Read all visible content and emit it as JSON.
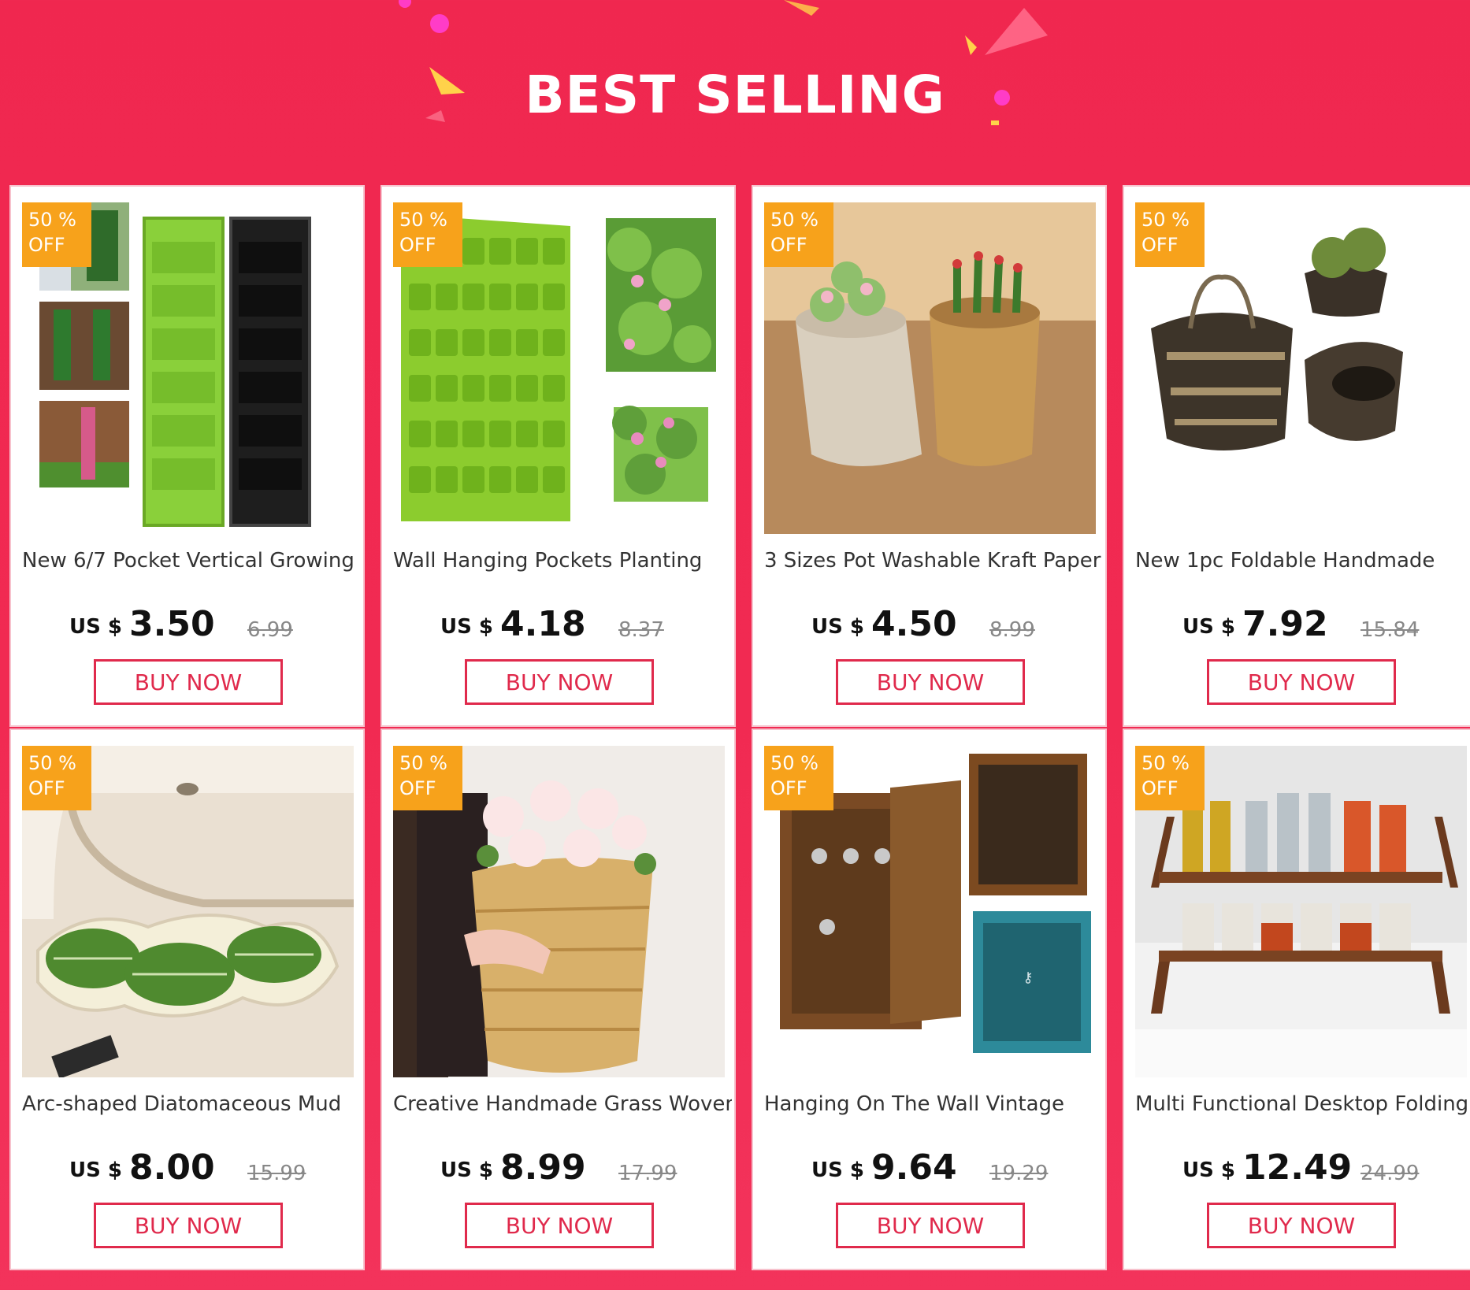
{
  "header": {
    "title": "BEST SELLING"
  },
  "products": [
    {
      "badge_pct": "50 %",
      "badge_off": "OFF",
      "title": "New 6/7 Pocket Vertical Growing",
      "currency": "US $",
      "price": "3.50",
      "old_price": "6.99",
      "button": "BUY NOW",
      "image": "vertical-pocket-planter"
    },
    {
      "badge_pct": "50 %",
      "badge_off": "OFF",
      "title": "Wall Hanging Pockets Planting",
      "currency": "US $",
      "price": "4.18",
      "old_price": "8.37",
      "button": "BUY NOW",
      "image": "wall-pocket-planter"
    },
    {
      "badge_pct": "50 %",
      "badge_off": "OFF",
      "title": "3  Sizes Pot Washable Kraft Paper",
      "currency": "US $",
      "price": "4.50",
      "old_price": "8.99",
      "button": "BUY NOW",
      "image": "kraft-paper-pots"
    },
    {
      "badge_pct": "50 %",
      "badge_off": "OFF",
      "title": "New 1pc Foldable Handmade",
      "currency": "US $",
      "price": "7.92",
      "old_price": "15.84",
      "button": "BUY NOW",
      "image": "seagrass-baskets"
    },
    {
      "badge_pct": "50 %",
      "badge_off": "OFF",
      "title": "Arc-shaped Diatomaceous Mud",
      "currency": "US $",
      "price": "8.00",
      "old_price": "15.99",
      "button": "BUY NOW",
      "image": "leaf-bath-mat"
    },
    {
      "badge_pct": "50 %",
      "badge_off": "OFF",
      "title": "Creative Handmade Grass Woven",
      "currency": "US $",
      "price": "8.99",
      "old_price": "17.99",
      "button": "BUY NOW",
      "image": "woven-flower-basket"
    },
    {
      "badge_pct": "50 %",
      "badge_off": "OFF",
      "title": "Hanging On The Wall Vintage",
      "currency": "US $",
      "price": "9.64",
      "old_price": "19.29",
      "button": "BUY NOW",
      "image": "key-cabinets"
    },
    {
      "badge_pct": "50 %",
      "badge_off": "OFF",
      "title": "Multi Functional Desktop Folding",
      "currency": "US $",
      "price": "12.49",
      "old_price": "24.99",
      "button": "BUY NOW",
      "image": "spice-rack"
    }
  ],
  "colors": {
    "accent": "#e02a4c",
    "badge": "#f7a21b",
    "background": "#f12a52"
  }
}
